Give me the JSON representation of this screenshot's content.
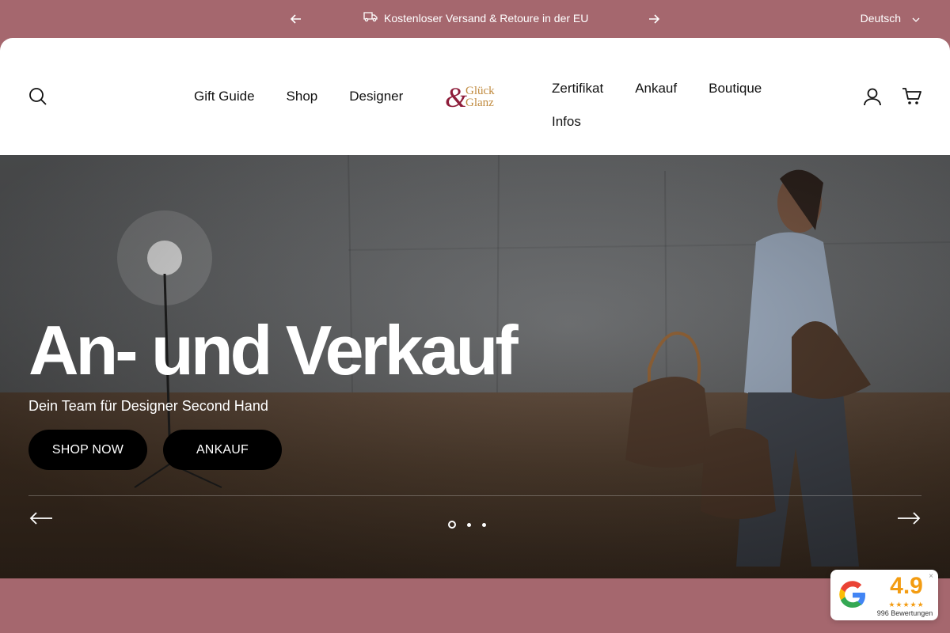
{
  "announcement": {
    "message": "Kostenloser Versand & Retoure in der EU",
    "language": "Deutsch"
  },
  "header": {
    "nav_left": [
      "Gift Guide",
      "Shop",
      "Designer"
    ],
    "logo": {
      "amp": "&",
      "line1": "Glück",
      "line2": "Glanz"
    },
    "nav_right_row1": [
      "Zertifikat",
      "Ankauf",
      "Boutique"
    ],
    "nav_right_row2": [
      "Infos"
    ]
  },
  "hero": {
    "title": "An- und Verkauf",
    "subtitle": "Dein Team für Designer Second Hand",
    "buttons": [
      "SHOP NOW",
      "ANKAUF"
    ],
    "slide_count": 3,
    "active_slide": 0
  },
  "reviews_badge": {
    "score": "4.9",
    "stars": "★★★★★",
    "count": "996 Bewertungen",
    "close": "×"
  },
  "colors": {
    "brand_rose": "#a5676e",
    "logo_burgundy": "#8e1d3a",
    "logo_gold": "#c08a3e",
    "rating_orange": "#f39c12"
  }
}
